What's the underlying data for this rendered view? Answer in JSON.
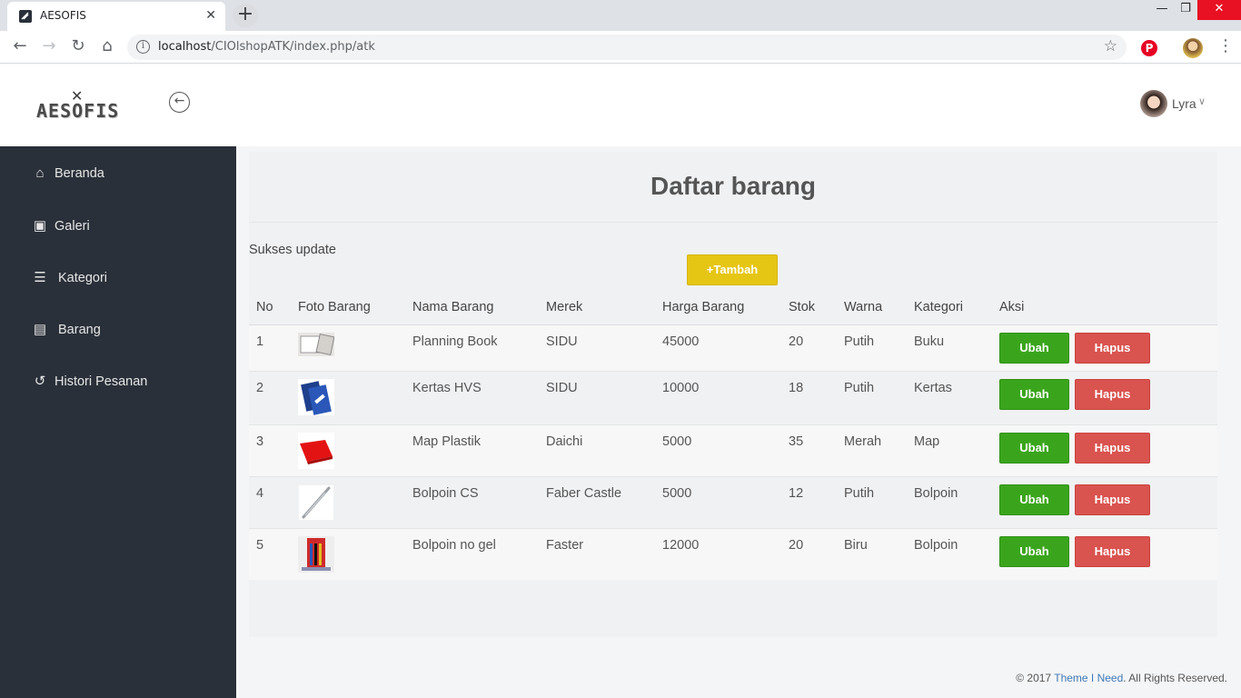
{
  "browser": {
    "tab_title": "AESOFIS",
    "url_host": "localhost",
    "url_path": "/CIOlshopATK/index.php/atk"
  },
  "header": {
    "logo_text": "AESOFIS",
    "user_name": "Lyra"
  },
  "sidebar": {
    "items": [
      {
        "label": "Beranda",
        "icon": "home-icon"
      },
      {
        "label": "Galeri",
        "icon": "image-file-icon"
      },
      {
        "label": "Kategori",
        "icon": "list-icon"
      },
      {
        "label": "Barang",
        "icon": "table-list-icon"
      },
      {
        "label": "Histori Pesanan",
        "icon": "history-icon"
      }
    ]
  },
  "main": {
    "title": "Daftar barang",
    "flash_message": "Sukses update",
    "add_button": "+Tambah",
    "columns": [
      "No",
      "Foto Barang",
      "Nama Barang",
      "Merek",
      "Harga Barang",
      "Stok",
      "Warna",
      "Kategori",
      "Aksi"
    ],
    "rows": [
      {
        "no": "1",
        "nama": "Planning Book",
        "merek": "SIDU",
        "harga": "45000",
        "stok": "20",
        "warna": "Putih",
        "kategori": "Buku"
      },
      {
        "no": "2",
        "nama": "Kertas HVS",
        "merek": "SIDU",
        "harga": "10000",
        "stok": "18",
        "warna": "Putih",
        "kategori": "Kertas"
      },
      {
        "no": "3",
        "nama": "Map Plastik",
        "merek": "Daichi",
        "harga": "5000",
        "stok": "35",
        "warna": "Merah",
        "kategori": "Map"
      },
      {
        "no": "4",
        "nama": "Bolpoin CS",
        "merek": "Faber Castle",
        "harga": "5000",
        "stok": "12",
        "warna": "Putih",
        "kategori": "Bolpoin"
      },
      {
        "no": "5",
        "nama": "Bolpoin no gel",
        "merek": "Faster",
        "harga": "12000",
        "stok": "20",
        "warna": "Biru",
        "kategori": "Bolpoin"
      }
    ],
    "edit_label": "Ubah",
    "delete_label": "Hapus"
  },
  "footer": {
    "prefix": "© 2017 ",
    "link": "Theme I Need",
    "suffix": ". All Rights Reserved."
  },
  "colors": {
    "sidebar_bg": "#2a3039",
    "add_button": "#e6c614",
    "edit_button": "#3aa51c",
    "delete_button": "#d9534f"
  }
}
